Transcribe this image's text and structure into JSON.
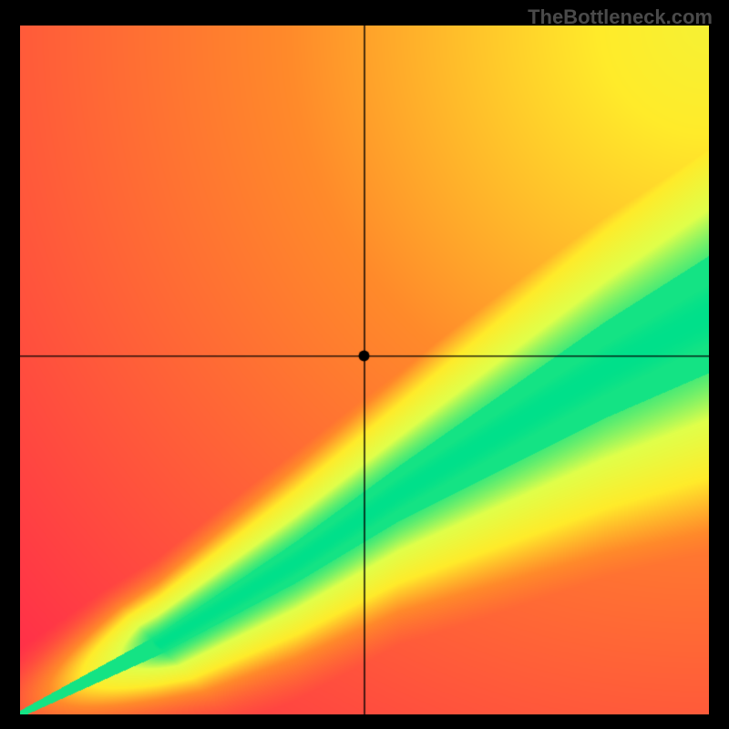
{
  "watermark": "TheBottleneck.com",
  "chart_data": {
    "type": "heatmap",
    "title": "",
    "xlabel": "",
    "ylabel": "",
    "xlim": [
      0,
      100
    ],
    "ylim": [
      0,
      100
    ],
    "crosshair": {
      "x": 50,
      "y": 52
    },
    "marker": {
      "x": 50,
      "y": 52
    },
    "colormap": [
      {
        "stop": 0.0,
        "color": "#ff2a4a"
      },
      {
        "stop": 0.35,
        "color": "#ff8a2a"
      },
      {
        "stop": 0.55,
        "color": "#ffeb2a"
      },
      {
        "stop": 0.78,
        "color": "#e0ff4a"
      },
      {
        "stop": 1.0,
        "color": "#00e08a"
      }
    ],
    "ridge": {
      "description": "Green optimum band along a slightly superlinear diagonal from lower-left to a region near (100, 55) widening toward the right.",
      "points": [
        {
          "x": 0,
          "y": 0,
          "half_width": 0.5
        },
        {
          "x": 20,
          "y": 10,
          "half_width": 1.5
        },
        {
          "x": 40,
          "y": 22,
          "half_width": 3
        },
        {
          "x": 55,
          "y": 32,
          "half_width": 4
        },
        {
          "x": 70,
          "y": 41,
          "half_width": 5.5
        },
        {
          "x": 85,
          "y": 50,
          "half_width": 7
        },
        {
          "x": 100,
          "y": 58,
          "half_width": 8.5
        }
      ]
    },
    "corner_tint": {
      "description": "Upper-right quadrant shifts toward yellow independent of ridge distance.",
      "center": {
        "x": 100,
        "y": 100
      },
      "radius": 140
    }
  }
}
